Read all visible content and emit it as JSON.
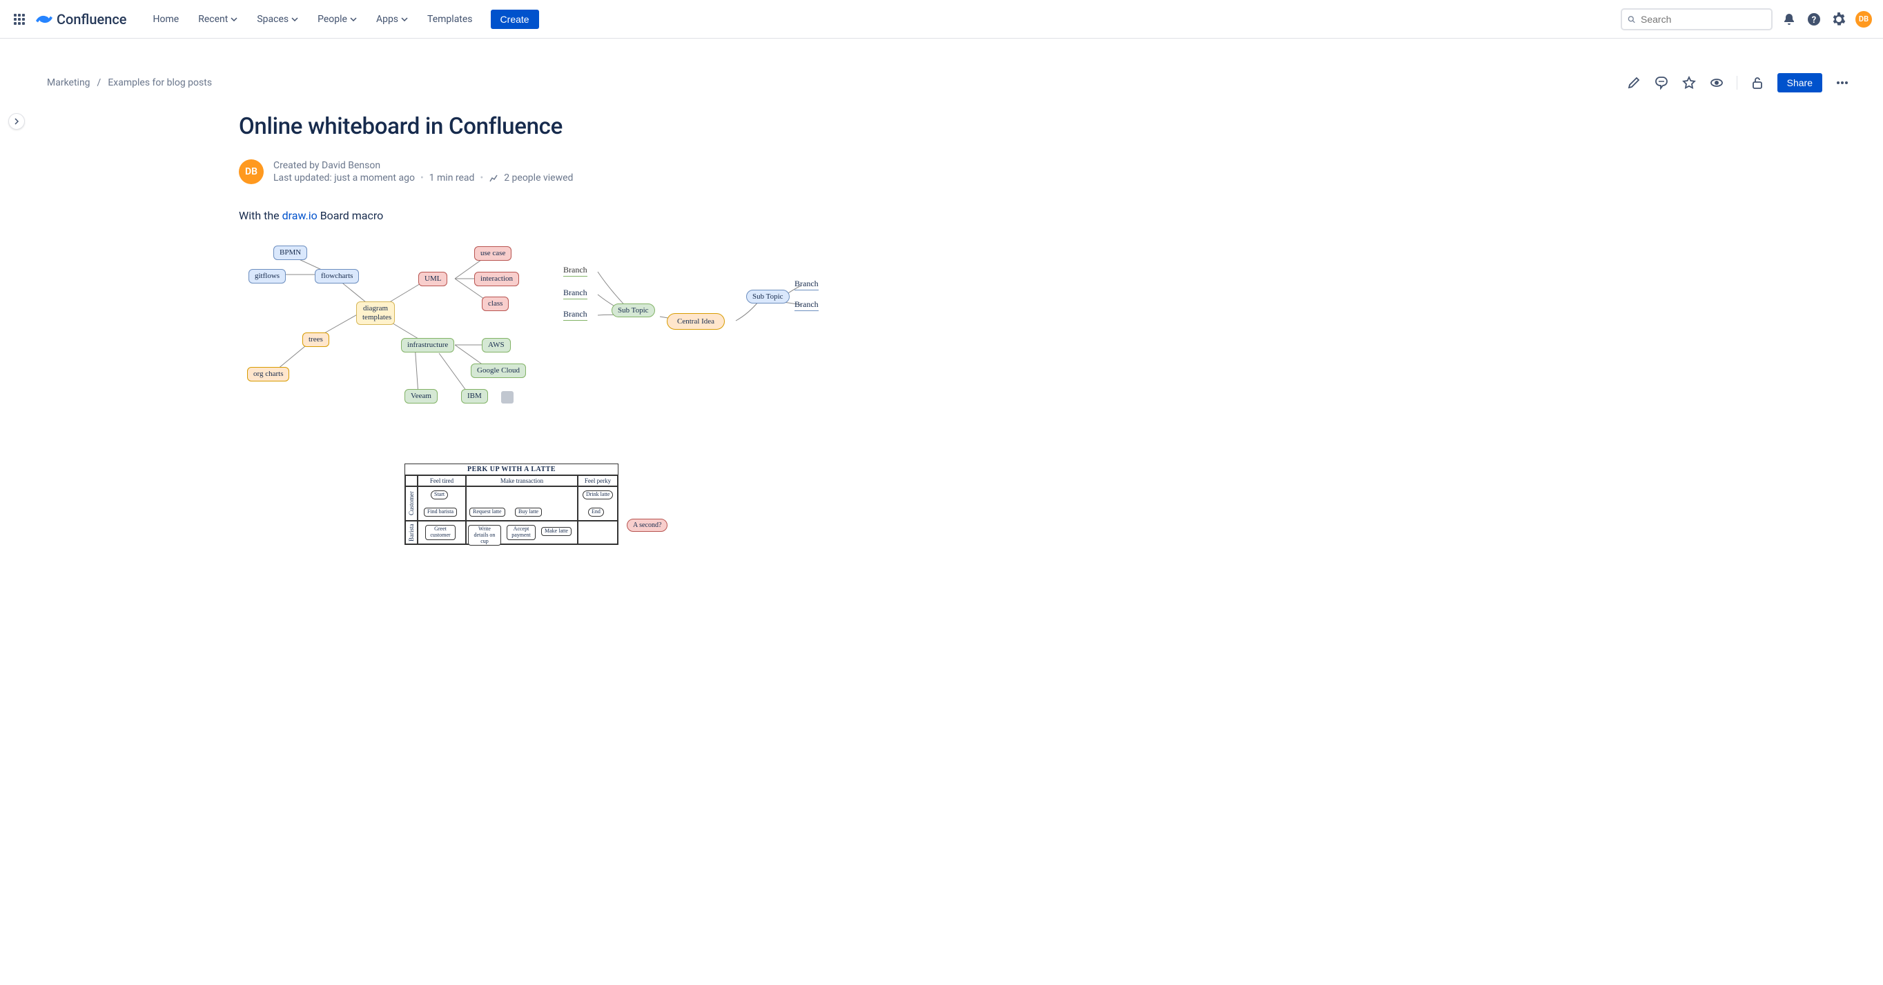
{
  "nav": {
    "product": "Confluence",
    "home": "Home",
    "recent": "Recent",
    "spaces": "Spaces",
    "people": "People",
    "apps": "Apps",
    "templates": "Templates",
    "create": "Create",
    "search_placeholder": "Search"
  },
  "user": {
    "initials": "DB"
  },
  "breadcrumbs": {
    "space": "Marketing",
    "parent": "Examples for blog posts"
  },
  "actions": {
    "share": "Share"
  },
  "page": {
    "title": "Online whiteboard in Confluence",
    "author_initials": "DB",
    "created_by": "Created by David Benson",
    "updated": "Last updated: just a moment ago",
    "read_time": "1 min read",
    "views": "2 people viewed",
    "intro_prefix": "With the ",
    "intro_link": "draw.io",
    "intro_suffix": " Board macro"
  },
  "diagram1": {
    "center": "diagram templates",
    "bpmn": "BPMN",
    "flowcharts": "flowcharts",
    "gitflows": "gitflows",
    "trees": "trees",
    "org_charts": "org charts",
    "uml": "UML",
    "use_case": "use case",
    "interaction": "interaction",
    "class": "class",
    "infrastructure": "infrastructure",
    "aws": "AWS",
    "google_cloud": "Google Cloud",
    "veeam": "Veeam",
    "ibm": "IBM"
  },
  "mindmap": {
    "central": "Central Idea",
    "sub_topic": "Sub Topic",
    "branch": "Branch"
  },
  "swimlane": {
    "title": "PERK UP WITH A LATTE",
    "col_feel_tired": "Feel tired",
    "col_make_transaction": "Make transaction",
    "col_feel_perky": "Feel perky",
    "lane_customer": "Customer",
    "lane_barista": "Barista",
    "start": "Start",
    "find_barista": "Find barista",
    "request_latte": "Request latte",
    "buy_latte": "Buy latte",
    "drink_latte": "Drink latte",
    "end": "End",
    "greet_customer": "Greet customer",
    "write_details": "Write details on cup",
    "accept_payment": "Accept payment",
    "make_latte": "Make latte",
    "callout": "A second?"
  }
}
